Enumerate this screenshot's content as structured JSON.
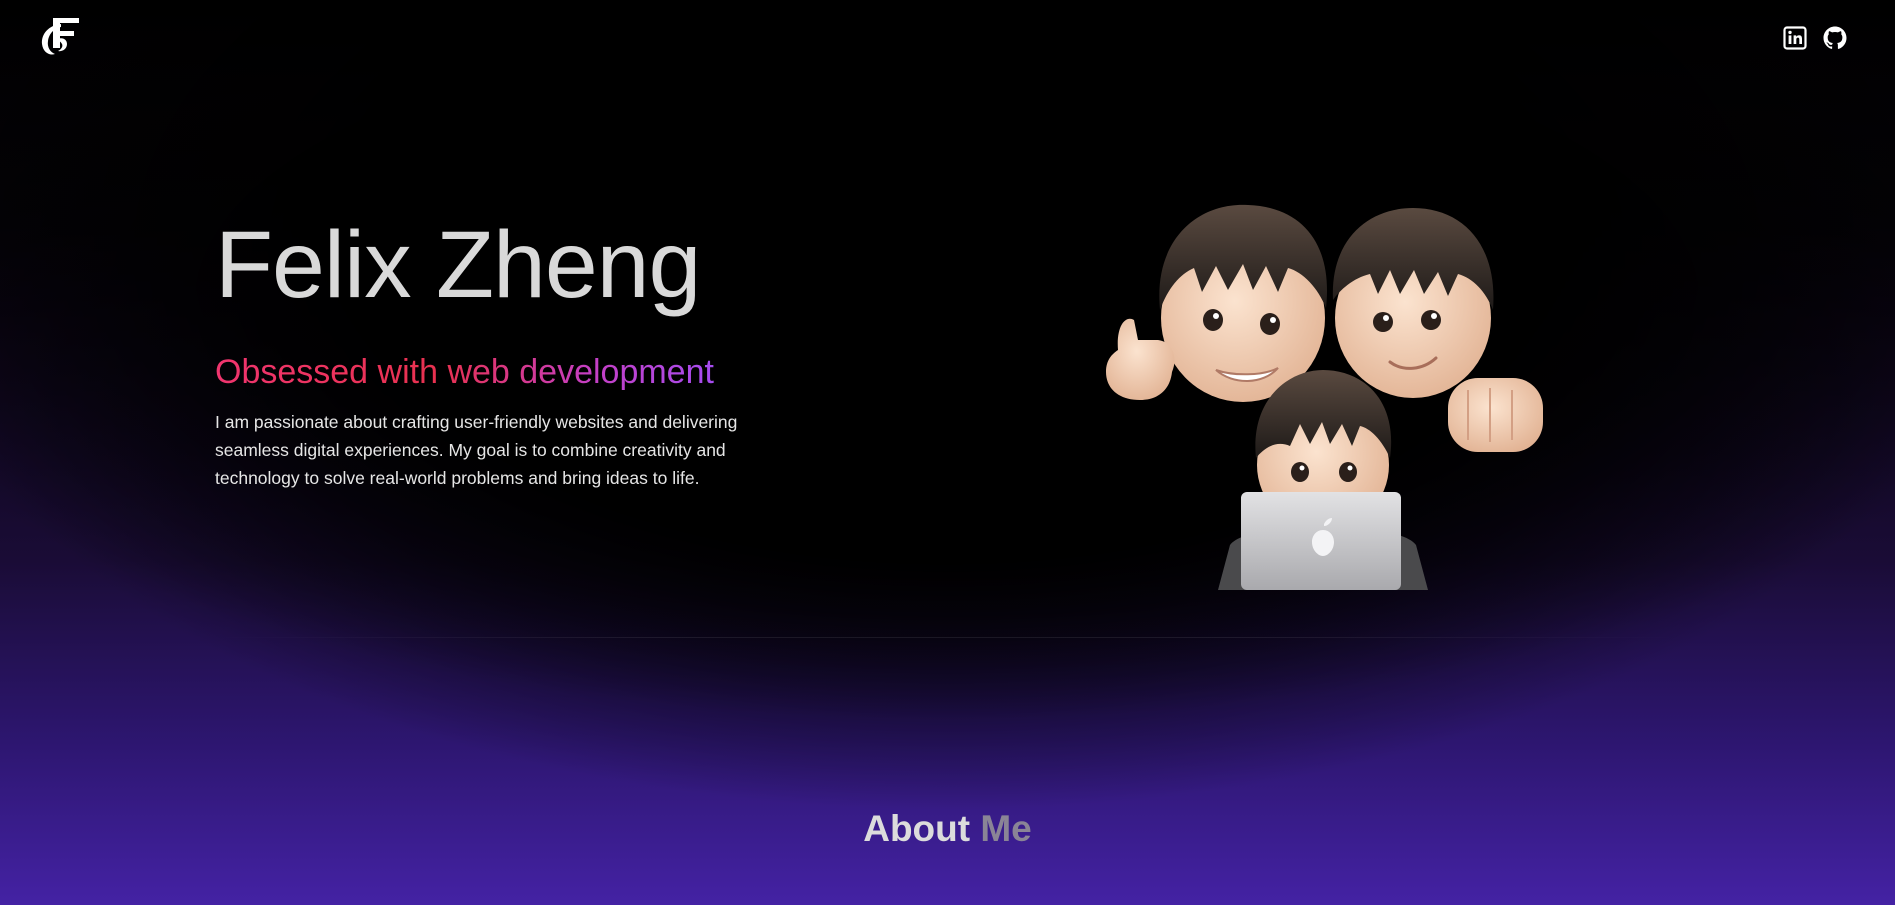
{
  "header": {
    "logo_icon": "f-monogram-logo",
    "social": [
      {
        "label": "LinkedIn",
        "icon": "linkedin-icon"
      },
      {
        "label": "GitHub",
        "icon": "github-icon"
      }
    ]
  },
  "hero": {
    "name": "Felix Zheng",
    "tagline": "Obsessed with web development",
    "bio": "I am passionate about crafting user-friendly websites and delivering seamless digital experiences. My goal is to combine creativity and technology to solve real-world problems and bring ideas to life.",
    "image": "memoji-group-illustration"
  },
  "about": {
    "title_first": "About",
    "title_second": "Me"
  },
  "colors": {
    "background": "#000000",
    "bottom_glow": "#4422a4",
    "tagline_start": "#f0356f",
    "tagline_end": "#a64cf0",
    "text_primary": "#d9d9d9",
    "text_muted": "#8a8496"
  }
}
